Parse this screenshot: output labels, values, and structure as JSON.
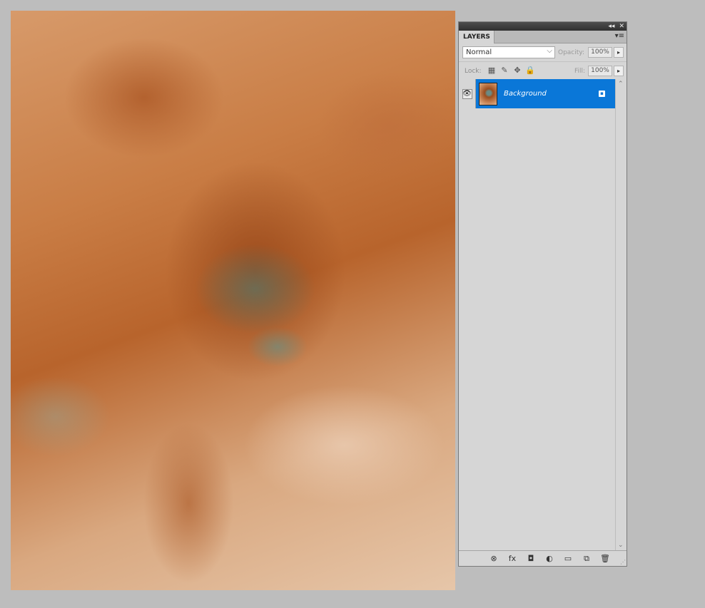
{
  "panel": {
    "tab_label": "LAYERS",
    "collapse_glyph": "◂◂",
    "close_glyph": "✕",
    "menu_glyph": "▾≡",
    "blend_mode": "Normal",
    "blend_arrow": "⌵",
    "opacity_label": "Opacity:",
    "opacity_value": "100%",
    "lock_label": "Lock:",
    "fill_label": "Fill:",
    "fill_value": "100%",
    "arrow_glyph": "▸",
    "layers": [
      {
        "name": "Background",
        "visible": true,
        "locked": true,
        "selected": true
      }
    ],
    "icons": {
      "eye": "eye-icon",
      "lock_transparent": "lock-transparent-pixels-icon",
      "lock_image": "lock-image-pixels-icon",
      "lock_position": "lock-position-icon",
      "lock_all": "lock-all-icon",
      "link": "link-layers-icon",
      "fx": "layer-style-icon",
      "mask": "add-mask-icon",
      "adjustment": "adjustment-layer-icon",
      "group": "new-group-icon",
      "new_layer": "new-layer-icon",
      "trash": "delete-layer-icon"
    },
    "glyphs": {
      "eye": "👁",
      "lock_transparent": "▦",
      "lock_image": "✎",
      "lock_position": "✥",
      "lock_all": "🔒",
      "scroll_up": "⌃",
      "scroll_down": "⌄",
      "link": "⊗",
      "fx": "fx",
      "mask": "◘",
      "adjustment": "◐",
      "group": "▭",
      "new_layer": "⧉",
      "trash": "🗑",
      "grip": "⋰",
      "layer_lock": "▪"
    }
  },
  "colors": {
    "selection": "#0a77d8",
    "background": "#bdbdbd"
  }
}
